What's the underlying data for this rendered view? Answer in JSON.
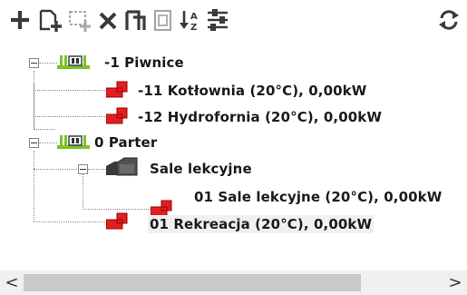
{
  "toolbar": {
    "buttons": [
      {
        "name": "add",
        "icon": "plus-icon",
        "enabled": true
      },
      {
        "name": "add-child",
        "icon": "add-document-icon",
        "enabled": true
      },
      {
        "name": "add-group",
        "icon": "add-group-icon",
        "enabled": false
      },
      {
        "name": "delete",
        "icon": "close-icon",
        "enabled": true
      },
      {
        "name": "copy",
        "icon": "copy-icon",
        "enabled": true
      },
      {
        "name": "paste",
        "icon": "paste-icon",
        "enabled": false
      },
      {
        "name": "sort",
        "icon": "sort-az-icon",
        "enabled": true
      },
      {
        "name": "floors",
        "icon": "floors-icon",
        "enabled": true
      },
      {
        "name": "refresh",
        "icon": "refresh-icon",
        "enabled": true
      }
    ]
  },
  "tree": {
    "nodes": [
      {
        "label": "-1 Piwnice",
        "type": "floor",
        "level": 0
      },
      {
        "label": "-11 Kotłownia (20°C), 0,00kW",
        "type": "room",
        "level": 1
      },
      {
        "label": "-12 Hydrofornia (20°C), 0,00kW",
        "type": "room",
        "level": 1
      },
      {
        "label": "0 Parter",
        "type": "floor",
        "level": 0
      },
      {
        "label": "Sale lekcyjne",
        "type": "group",
        "level": 1
      },
      {
        "label": "01 Sale lekcyjne (20°C), 0,00kW",
        "type": "room",
        "level": 2
      },
      {
        "label": "01 Rekreacja (20°C), 0,00kW",
        "type": "room",
        "level": 1,
        "selected": true
      }
    ]
  },
  "scrollbar": {
    "left_arrow": "<",
    "right_arrow": ">"
  },
  "colors": {
    "toolbar_icon": "#3a3a3a",
    "disabled_icon": "#a8a8a8",
    "floor_icon": "#7fbf2a",
    "room_icon": "#e02020",
    "group_icon": "#3a3a3a",
    "selection_bg": "#f0f0f0",
    "scrollbar_bg": "#f0f0f0",
    "scrollbar_thumb": "#c9c9c9"
  }
}
